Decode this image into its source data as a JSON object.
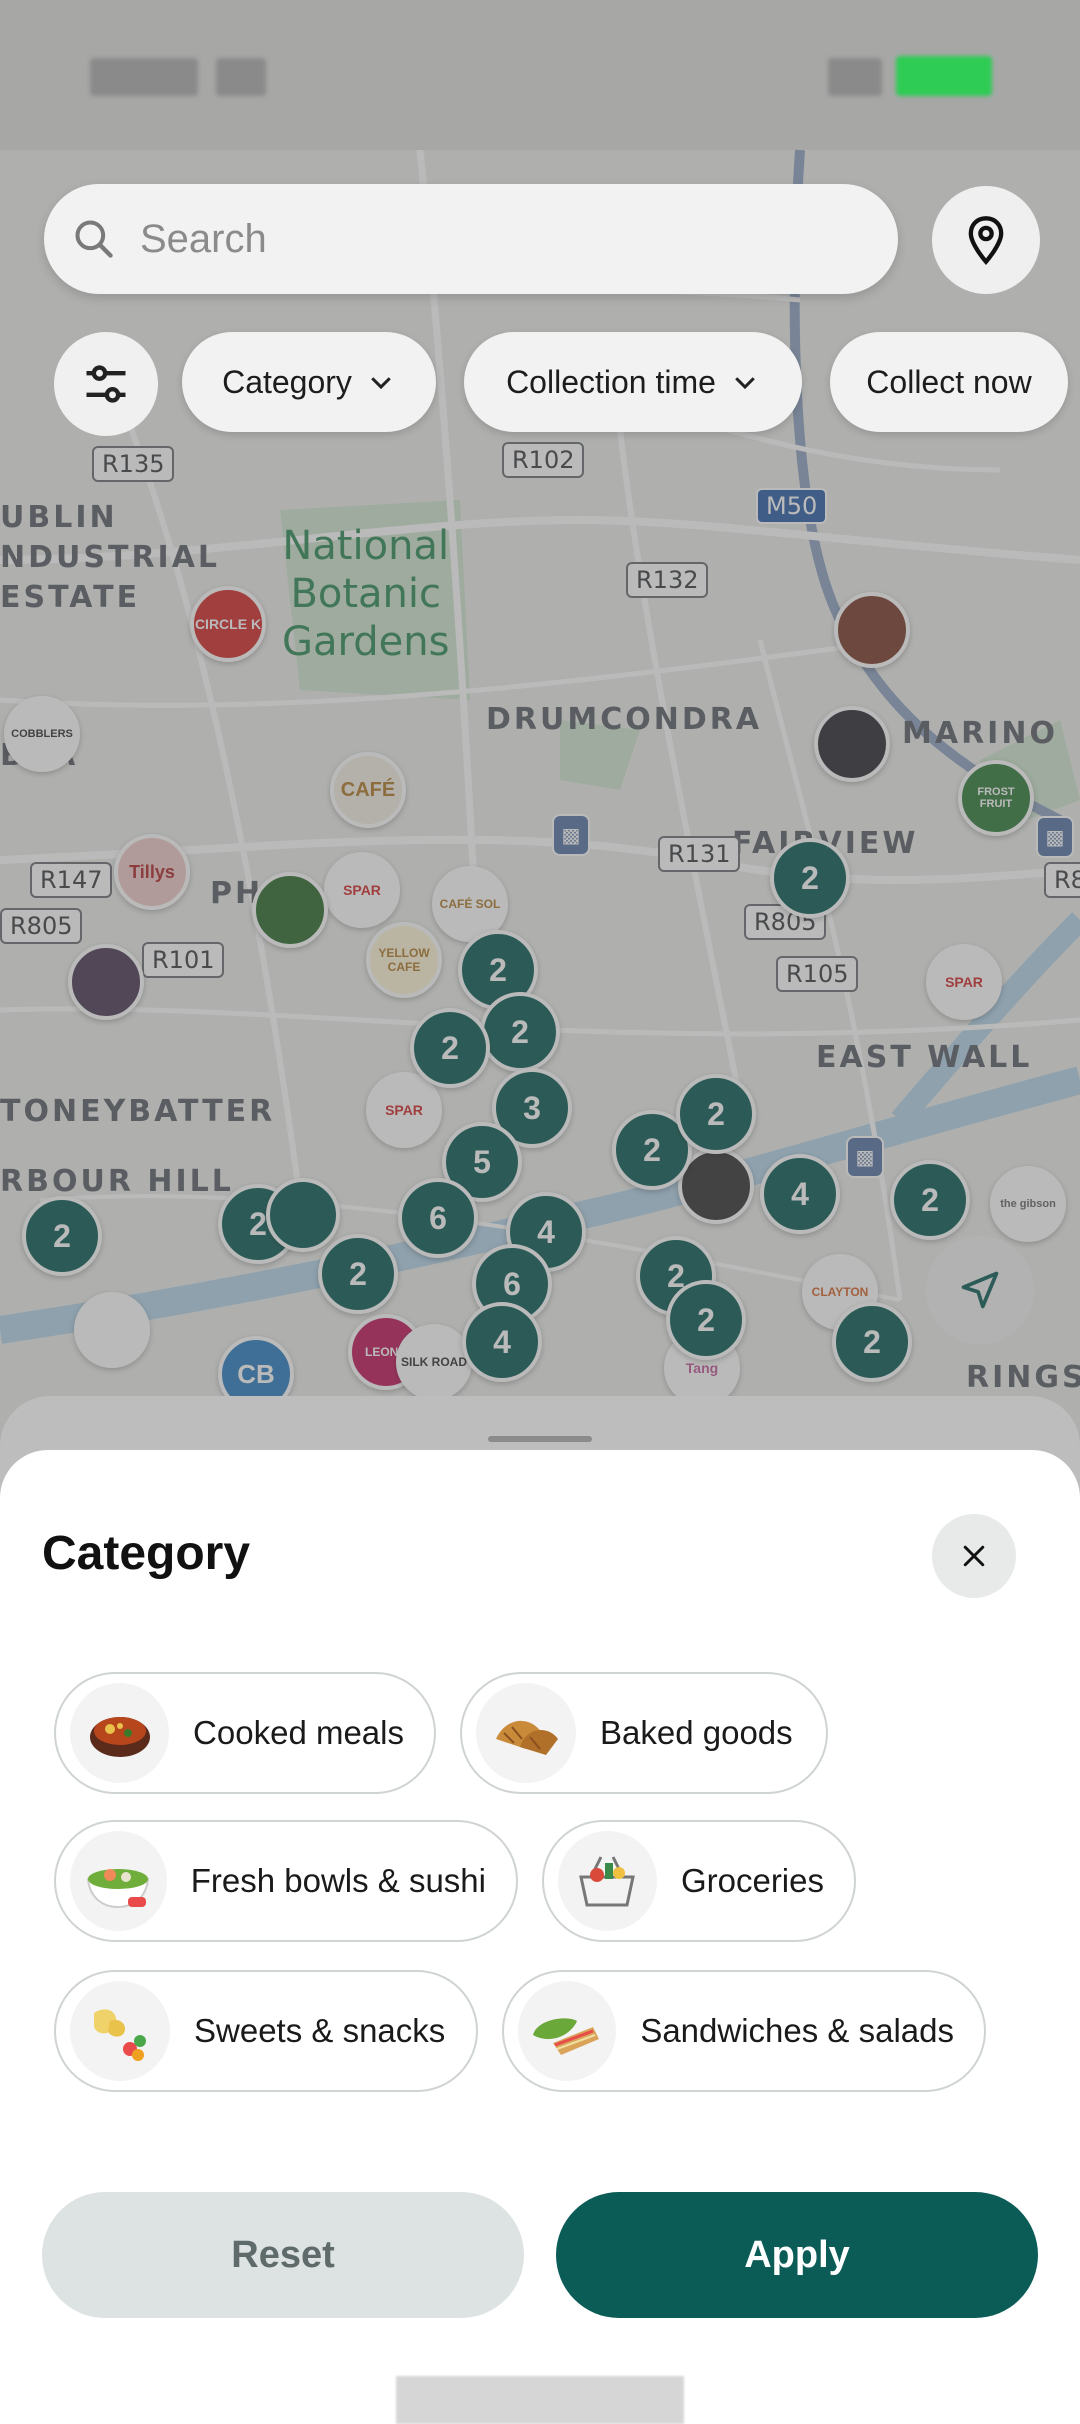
{
  "search": {
    "placeholder": "Search"
  },
  "chips": {
    "category": "Category",
    "collection_time": "Collection time",
    "collect_now": "Collect now"
  },
  "map": {
    "areas": [
      "UBLIN",
      "NDUSTRIAL",
      "ESTATE",
      "BRA",
      "DRUMCONDRA",
      "MARINO",
      "FAIRVIEW",
      "PH",
      "EAST WALL",
      "TONEYBATTER",
      "RBOUR HILL",
      "RINGS"
    ],
    "park": [
      "National",
      "Botanic",
      "Gardens"
    ],
    "roads": [
      "R135",
      "R102",
      "M50",
      "R132",
      "R147",
      "R805",
      "R101",
      "R131",
      "R805",
      "R105",
      "R8"
    ],
    "clusters": [
      "2",
      "2",
      "2",
      "3",
      "5",
      "2",
      "2",
      "6",
      "4",
      "6",
      "4",
      "2",
      "4",
      "2",
      "2",
      "2",
      "2",
      "2",
      "2",
      "2",
      "2"
    ],
    "store_labels": [
      "CIRCLE K",
      "CAFÉ",
      "SPAR",
      "Tillys",
      "YELLOW CAFE",
      "SPAR",
      "SPAR",
      "CLAYTON",
      "CB",
      "LEONA",
      "SILK ROAD",
      "CAFÉ SOL",
      "COBBLERS",
      "FROST FRUIT",
      "the gibson",
      "Tang"
    ]
  },
  "sheet": {
    "title": "Category",
    "categories": [
      {
        "label": "Cooked meals",
        "icon": "cooked-meal-icon"
      },
      {
        "label": "Baked goods",
        "icon": "baked-goods-icon"
      },
      {
        "label": "Fresh bowls & sushi",
        "icon": "sushi-bowl-icon"
      },
      {
        "label": "Groceries",
        "icon": "grocery-basket-icon"
      },
      {
        "label": "Sweets & snacks",
        "icon": "snacks-icon"
      },
      {
        "label": "Sandwiches & salads",
        "icon": "sandwich-icon"
      }
    ],
    "reset_label": "Reset",
    "apply_label": "Apply"
  },
  "colors": {
    "brand": "#0b5c56",
    "reset_bg": "#dde2e2"
  }
}
